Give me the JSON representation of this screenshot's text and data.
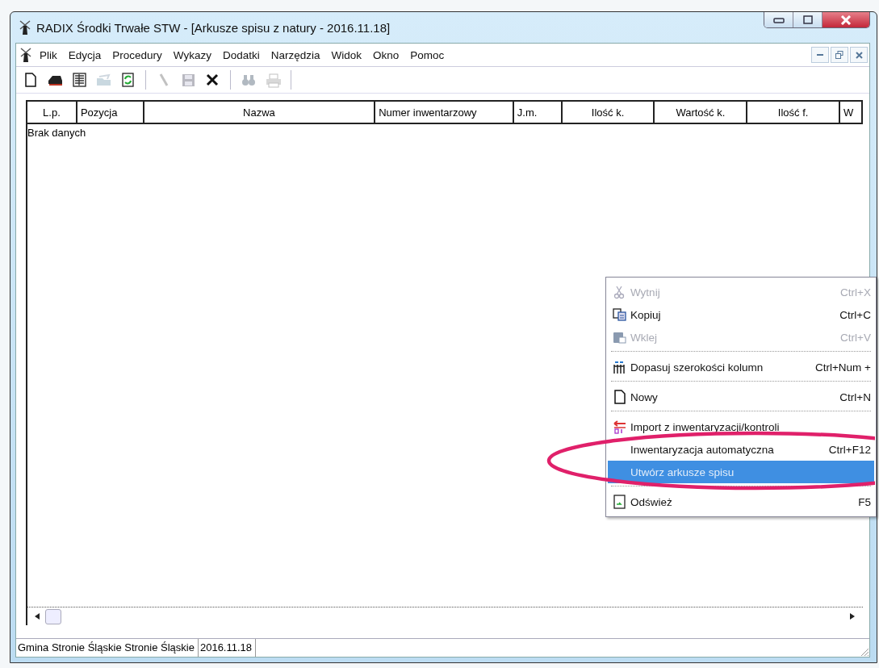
{
  "window": {
    "title": "RADIX Środki Trwałe STW - [Arkusze spisu z natury - 2016.11.18]"
  },
  "menu": [
    "Plik",
    "Edycja",
    "Procedury",
    "Wykazy",
    "Dodatki",
    "Narzędzia",
    "Widok",
    "Okno",
    "Pomoc"
  ],
  "toolbar": [
    {
      "kind": "button",
      "disabled": false
    },
    {
      "kind": "button",
      "disabled": false
    },
    {
      "kind": "button",
      "disabled": false
    },
    {
      "kind": "button",
      "disabled": true
    },
    {
      "kind": "button",
      "disabled": false
    },
    {
      "kind": "separator"
    },
    {
      "kind": "button",
      "disabled": true
    },
    {
      "kind": "button",
      "disabled": true
    },
    {
      "kind": "button",
      "disabled": false
    },
    {
      "kind": "separator"
    },
    {
      "kind": "button",
      "disabled": true
    },
    {
      "kind": "button",
      "disabled": true
    },
    {
      "kind": "separator"
    }
  ],
  "table": {
    "columns": [
      "L.p.",
      "Pozycja",
      "Nazwa",
      "Numer inwentarzowy",
      "J.m.",
      "Ilość k.",
      "Wartość k.",
      "Ilość f.",
      "W"
    ],
    "empty_text": "Brak danych"
  },
  "context_menu": {
    "items": [
      {
        "kind": "item",
        "label": "Wytnij",
        "shortcut": "Ctrl+X",
        "disabled": true,
        "selected": false
      },
      {
        "kind": "item",
        "label": "Kopiuj",
        "shortcut": "Ctrl+C",
        "disabled": false,
        "selected": false
      },
      {
        "kind": "item",
        "label": "Wklej",
        "shortcut": "Ctrl+V",
        "disabled": true,
        "selected": false
      },
      {
        "kind": "separator"
      },
      {
        "kind": "item",
        "label": "Dopasuj szerokości kolumn",
        "shortcut": "Ctrl+Num +",
        "disabled": false,
        "selected": false
      },
      {
        "kind": "separator"
      },
      {
        "kind": "item",
        "label": "Nowy",
        "shortcut": "Ctrl+N",
        "disabled": false,
        "selected": false
      },
      {
        "kind": "separator"
      },
      {
        "kind": "item",
        "label": "Import z inwentaryzacji/kontroli",
        "disabled": false,
        "selected": false
      },
      {
        "kind": "item",
        "label": "Inwentaryzacja automatyczna",
        "shortcut": "Ctrl+F12",
        "disabled": false,
        "selected": false
      },
      {
        "kind": "item",
        "label": "Utwórz arkusze spisu",
        "disabled": true,
        "selected": true
      },
      {
        "kind": "separator"
      },
      {
        "kind": "item",
        "label": "Odśwież",
        "shortcut": "F5",
        "disabled": false,
        "selected": false
      }
    ]
  },
  "status_bar": [
    "Gmina Stronie Śląskie Stronie Śląskie",
    "2016.11.18"
  ]
}
